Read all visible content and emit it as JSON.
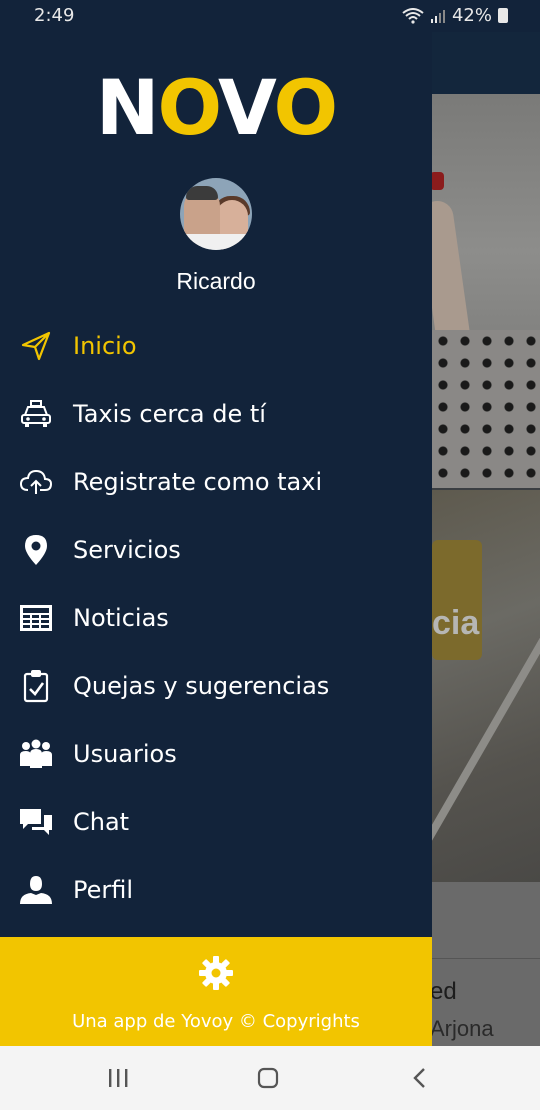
{
  "status_bar": {
    "time": "2:49",
    "battery": "42%"
  },
  "logo": {
    "part1": "N",
    "part2": "O",
    "part3": "V",
    "part4": "O"
  },
  "user": {
    "name": "Ricardo"
  },
  "menu": {
    "items": [
      {
        "label": "Inicio",
        "icon": "send-icon",
        "active": true
      },
      {
        "label": "Taxis cerca de tí",
        "icon": "taxi-icon"
      },
      {
        "label": "Registrate como taxi",
        "icon": "cloud-upload-icon"
      },
      {
        "label": "Servicios",
        "icon": "map-pin-icon"
      },
      {
        "label": "Noticias",
        "icon": "newspaper-icon"
      },
      {
        "label": "Quejas y sugerencias",
        "icon": "clipboard-check-icon"
      },
      {
        "label": "Usuarios",
        "icon": "users-icon"
      },
      {
        "label": "Chat",
        "icon": "chat-icon"
      },
      {
        "label": "Perfil",
        "icon": "user-icon"
      }
    ]
  },
  "footer": {
    "text": "Una app de Yovoy © Copyrights"
  },
  "background": {
    "overlay_text": "cia",
    "card_title": "ed",
    "card_subtitle": "Arjona"
  },
  "colors": {
    "accent": "#f2c500",
    "drawer": "#12233a"
  }
}
